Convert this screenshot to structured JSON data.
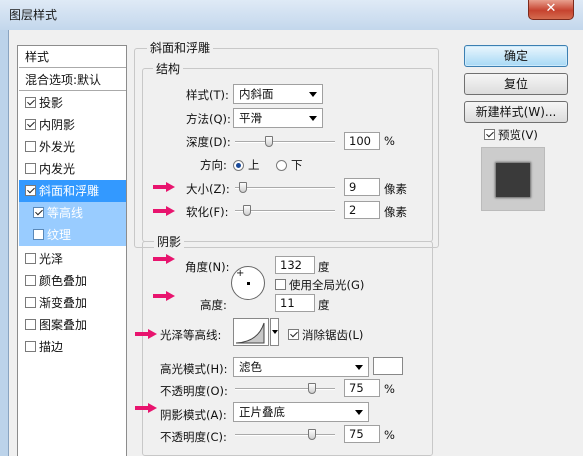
{
  "window": {
    "title": "图层样式",
    "close": "✕"
  },
  "styles_list": {
    "header": "样式",
    "blend": "混合选项:默认",
    "items": [
      {
        "label": "投影",
        "checked": true
      },
      {
        "label": "内阴影",
        "checked": true
      },
      {
        "label": "外发光",
        "checked": false
      },
      {
        "label": "内发光",
        "checked": false
      },
      {
        "label": "斜面和浮雕",
        "checked": true
      },
      {
        "label": "等高线",
        "checked": true
      },
      {
        "label": "纹理",
        "checked": false
      },
      {
        "label": "光泽",
        "checked": false
      },
      {
        "label": "颜色叠加",
        "checked": false
      },
      {
        "label": "渐变叠加",
        "checked": false
      },
      {
        "label": "图案叠加",
        "checked": false
      },
      {
        "label": "描边",
        "checked": false
      }
    ]
  },
  "bevel": {
    "group_title": "斜面和浮雕",
    "structure_title": "结构",
    "style_label": "样式(T):",
    "style_value": "内斜面",
    "method_label": "方法(Q):",
    "method_value": "平滑",
    "depth_label": "深度(D):",
    "depth_value": "100",
    "depth_unit": "%",
    "direction_label": "方向:",
    "dir_up": "上",
    "dir_down": "下",
    "size_label": "大小(Z):",
    "size_value": "9",
    "size_unit": "像素",
    "soften_label": "软化(F):",
    "soften_value": "2",
    "soften_unit": "像素"
  },
  "shading": {
    "title": "阴影",
    "angle_label": "角度(N):",
    "angle_value": "132",
    "angle_unit": "度",
    "global_light_label": "使用全局光(G)",
    "altitude_label": "高度:",
    "altitude_value": "11",
    "altitude_unit": "度",
    "gloss_label": "光泽等高线:",
    "antialias_label": "消除锯齿(L)",
    "highlight_mode_label": "高光模式(H):",
    "highlight_mode_value": "滤色",
    "highlight_opacity_label": "不透明度(O):",
    "highlight_opacity_value": "75",
    "highlight_opacity_unit": "%",
    "shadow_mode_label": "阴影模式(A):",
    "shadow_mode_value": "正片叠底",
    "shadow_opacity_label": "不透明度(C):",
    "shadow_opacity_value": "75",
    "shadow_opacity_unit": "%"
  },
  "buttons": {
    "ok": "确定",
    "reset": "复位",
    "new_style": "新建样式(W)...",
    "preview": "预览(V)"
  },
  "colors": {
    "accent_marker": "#e8146e",
    "selection": "#3399ff"
  }
}
